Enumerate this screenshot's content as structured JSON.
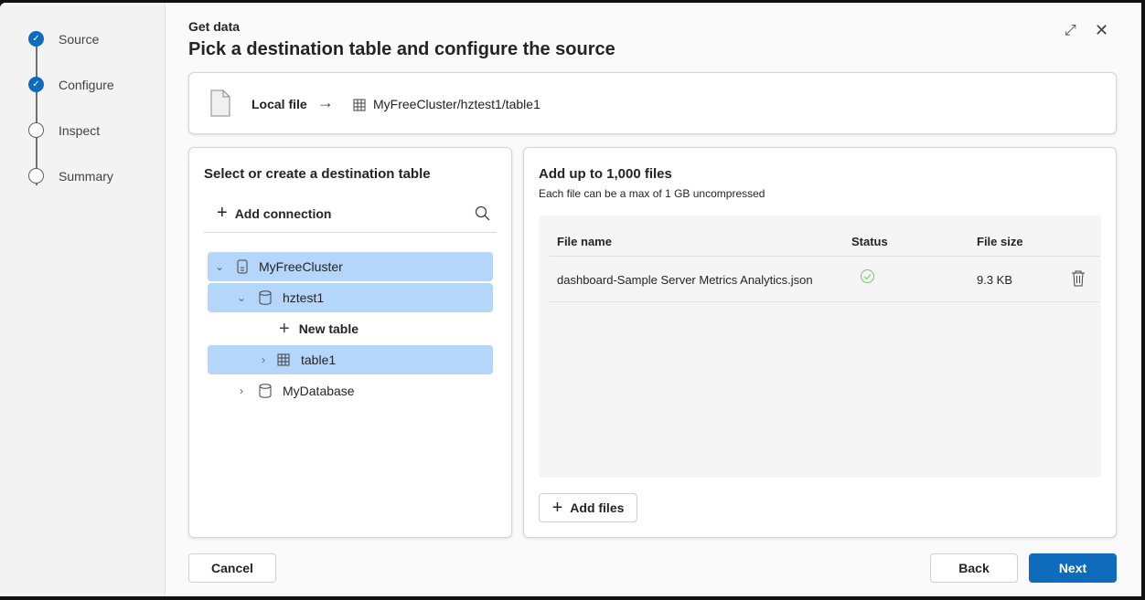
{
  "steps": [
    {
      "label": "Source",
      "state": "done"
    },
    {
      "label": "Configure",
      "state": "done"
    },
    {
      "label": "Inspect",
      "state": "todo"
    },
    {
      "label": "Summary",
      "state": "todo"
    }
  ],
  "header": {
    "subtitle": "Get data",
    "title": "Pick a destination table and configure the source"
  },
  "source_bar": {
    "source": "Local file",
    "destination": "MyFreeCluster/hztest1/table1"
  },
  "left_panel": {
    "title": "Select or create a destination table",
    "add_connection": "Add connection",
    "tree": [
      {
        "label": "MyFreeCluster",
        "icon": "cluster-icon",
        "selected": true,
        "expanded": true
      },
      {
        "label": "hztest1",
        "icon": "database-icon",
        "selected": true,
        "expanded": true
      },
      {
        "label": "New table",
        "icon": "plus-icon",
        "selected": false
      },
      {
        "label": "table1",
        "icon": "table-icon",
        "selected": true,
        "expanded": false
      },
      {
        "label": "MyDatabase",
        "icon": "database-icon",
        "selected": false,
        "expanded": false
      }
    ]
  },
  "right_panel": {
    "title": "Add up to 1,000 files",
    "subtitle": "Each file can be a max of 1 GB uncompressed",
    "columns": [
      "File name",
      "Status",
      "File size"
    ],
    "files": [
      {
        "name": "dashboard-Sample Server Metrics Analytics.json",
        "status": "success",
        "size": "9.3 KB"
      }
    ],
    "add_files": "Add files"
  },
  "footer": {
    "cancel": "Cancel",
    "back": "Back",
    "next": "Next"
  },
  "colors": {
    "accent": "#0f6cbd",
    "selected": "#b4d6fa",
    "success": "#6ccb5f"
  }
}
